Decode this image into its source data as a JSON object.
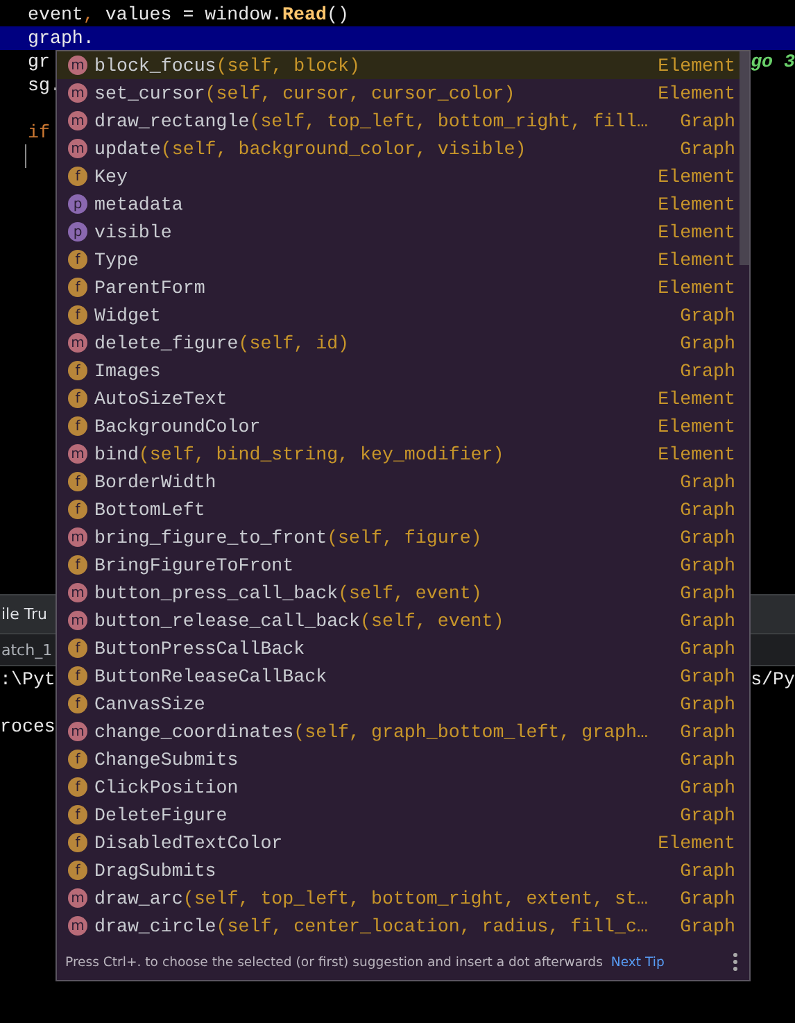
{
  "editor": {
    "lines": [
      {
        "current": false,
        "tokens": [
          {
            "text": "event",
            "kind": "plain"
          },
          {
            "text": ",",
            "kind": "punct"
          },
          {
            "text": " values = window.",
            "kind": "plain"
          },
          {
            "text": "Read",
            "kind": "call"
          },
          {
            "text": "()",
            "kind": "plain"
          }
        ]
      },
      {
        "current": true,
        "tokens": [
          {
            "text": "graph.",
            "kind": "plain"
          }
        ]
      },
      {
        "current": false,
        "tokens": [
          {
            "text": "gr",
            "kind": "plain"
          }
        ],
        "right": "go 3"
      },
      {
        "current": false,
        "tokens": [
          {
            "text": "sg.",
            "kind": "plain"
          }
        ]
      },
      {
        "current": false
      },
      {
        "current": false,
        "tokens": [
          {
            "text": "if",
            "kind": "keyword"
          }
        ]
      },
      {
        "current": false,
        "caret": true
      }
    ]
  },
  "tool_window": {
    "title": "ile Tru",
    "tab": "atch_1",
    "console": [
      {
        "left": ":\\Pyt",
        "right": "s/Py"
      },
      {
        "left": "roces"
      }
    ]
  },
  "completion": {
    "items": [
      {
        "kind": "method",
        "badge": "m",
        "name": "block_focus",
        "params": "(self, block)",
        "type": "Element",
        "selected": true
      },
      {
        "kind": "method",
        "badge": "m",
        "name": "set_cursor",
        "params": "(self, cursor, cursor_color)",
        "type": "Element",
        "selected": false
      },
      {
        "kind": "method",
        "badge": "m",
        "name": "draw_rectangle",
        "params": "(self, top_left, bottom_right, fill…",
        "type": "Graph",
        "selected": false
      },
      {
        "kind": "method",
        "badge": "m",
        "name": "update",
        "params": "(self, background_color, visible)",
        "type": "Graph",
        "selected": false
      },
      {
        "kind": "field",
        "badge": "f",
        "name": "Key",
        "type": "Element",
        "selected": false
      },
      {
        "kind": "property",
        "badge": "p",
        "name": "metadata",
        "type": "Element",
        "selected": false
      },
      {
        "kind": "property",
        "badge": "p",
        "name": "visible",
        "type": "Element",
        "selected": false
      },
      {
        "kind": "field",
        "badge": "f",
        "name": "Type",
        "type": "Element",
        "selected": false
      },
      {
        "kind": "field",
        "badge": "f",
        "name": "ParentForm",
        "type": "Element",
        "selected": false
      },
      {
        "kind": "field",
        "badge": "f",
        "name": "Widget",
        "type": "Graph",
        "selected": false
      },
      {
        "kind": "method",
        "badge": "m",
        "name": "delete_figure",
        "params": "(self, id)",
        "type": "Graph",
        "selected": false
      },
      {
        "kind": "field",
        "badge": "f",
        "name": "Images",
        "type": "Graph",
        "selected": false
      },
      {
        "kind": "field",
        "badge": "f",
        "name": "AutoSizeText",
        "type": "Element",
        "selected": false
      },
      {
        "kind": "field",
        "badge": "f",
        "name": "BackgroundColor",
        "type": "Element",
        "selected": false
      },
      {
        "kind": "method",
        "badge": "m",
        "name": "bind",
        "params": "(self, bind_string, key_modifier)",
        "type": "Element",
        "selected": false
      },
      {
        "kind": "field",
        "badge": "f",
        "name": "BorderWidth",
        "type": "Graph",
        "selected": false
      },
      {
        "kind": "field",
        "badge": "f",
        "name": "BottomLeft",
        "type": "Graph",
        "selected": false
      },
      {
        "kind": "method",
        "badge": "m",
        "name": "bring_figure_to_front",
        "params": "(self, figure)",
        "type": "Graph",
        "selected": false
      },
      {
        "kind": "field",
        "badge": "f",
        "name": "BringFigureToFront",
        "type": "Graph",
        "selected": false
      },
      {
        "kind": "method",
        "badge": "m",
        "name": "button_press_call_back",
        "params": "(self, event)",
        "type": "Graph",
        "selected": false
      },
      {
        "kind": "method",
        "badge": "m",
        "name": "button_release_call_back",
        "params": "(self, event)",
        "type": "Graph",
        "selected": false
      },
      {
        "kind": "field",
        "badge": "f",
        "name": "ButtonPressCallBack",
        "type": "Graph",
        "selected": false
      },
      {
        "kind": "field",
        "badge": "f",
        "name": "ButtonReleaseCallBack",
        "type": "Graph",
        "selected": false
      },
      {
        "kind": "field",
        "badge": "f",
        "name": "CanvasSize",
        "type": "Graph",
        "selected": false
      },
      {
        "kind": "method",
        "badge": "m",
        "name": "change_coordinates",
        "params": "(self, graph_bottom_left, graph…",
        "type": "Graph",
        "selected": false
      },
      {
        "kind": "field",
        "badge": "f",
        "name": "ChangeSubmits",
        "type": "Graph",
        "selected": false
      },
      {
        "kind": "field",
        "badge": "f",
        "name": "ClickPosition",
        "type": "Graph",
        "selected": false
      },
      {
        "kind": "field",
        "badge": "f",
        "name": "DeleteFigure",
        "type": "Graph",
        "selected": false
      },
      {
        "kind": "field",
        "badge": "f",
        "name": "DisabledTextColor",
        "type": "Element",
        "selected": false
      },
      {
        "kind": "field",
        "badge": "f",
        "name": "DragSubmits",
        "type": "Graph",
        "selected": false
      },
      {
        "kind": "method",
        "badge": "m",
        "name": "draw_arc",
        "params": "(self, top_left, bottom_right, extent, st…",
        "type": "Graph",
        "selected": false
      },
      {
        "kind": "method",
        "badge": "m",
        "name": "draw_circle",
        "params": "(self, center_location, radius, fill_c…",
        "type": "Graph",
        "selected": false
      }
    ],
    "hint": "Press Ctrl+. to choose the selected (or first) suggestion and insert a dot afterwards",
    "link": "Next Tip"
  }
}
